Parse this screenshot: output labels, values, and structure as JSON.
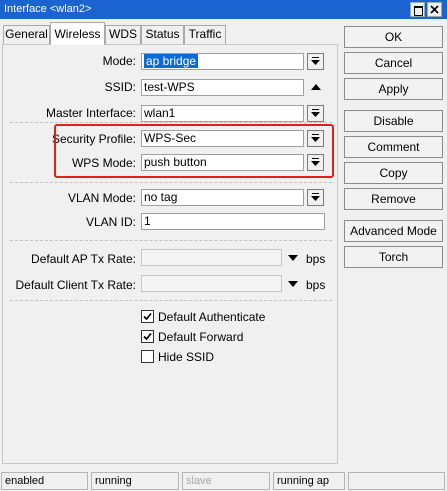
{
  "window": {
    "title": "Interface <wlan2>"
  },
  "tabs": [
    {
      "label": "General"
    },
    {
      "label": "Wireless"
    },
    {
      "label": "WDS"
    },
    {
      "label": "Status"
    },
    {
      "label": "Traffic"
    }
  ],
  "active_tab": "Wireless",
  "form": {
    "mode": {
      "label": "Mode:",
      "value": "ap bridge"
    },
    "ssid": {
      "label": "SSID:",
      "value": "test-WPS"
    },
    "master_interface": {
      "label": "Master Interface:",
      "value": "wlan1"
    },
    "security_profile": {
      "label": "Security Profile:",
      "value": "WPS-Sec"
    },
    "wps_mode": {
      "label": "WPS Mode:",
      "value": "push button"
    },
    "vlan_mode": {
      "label": "VLAN Mode:",
      "value": "no tag"
    },
    "vlan_id": {
      "label": "VLAN ID:",
      "value": "1"
    },
    "default_ap_tx_rate": {
      "label": "Default AP Tx Rate:",
      "value": "",
      "unit": "bps"
    },
    "default_client_tx_rate": {
      "label": "Default Client Tx Rate:",
      "value": "",
      "unit": "bps"
    },
    "checkboxes": {
      "default_authenticate": {
        "label": "Default Authenticate",
        "checked": true
      },
      "default_forward": {
        "label": "Default Forward",
        "checked": true
      },
      "hide_ssid": {
        "label": "Hide SSID",
        "checked": false
      }
    }
  },
  "buttons": {
    "ok": "OK",
    "cancel": "Cancel",
    "apply": "Apply",
    "disable": "Disable",
    "comment": "Comment",
    "copy": "Copy",
    "remove": "Remove",
    "advanced_mode": "Advanced Mode",
    "torch": "Torch"
  },
  "status_bar": [
    "enabled",
    "running",
    "slave",
    "running ap",
    ""
  ],
  "colors": {
    "titlebar": "#1a63d0",
    "highlight": "#e0201a",
    "selection": "#0a6ad6"
  }
}
